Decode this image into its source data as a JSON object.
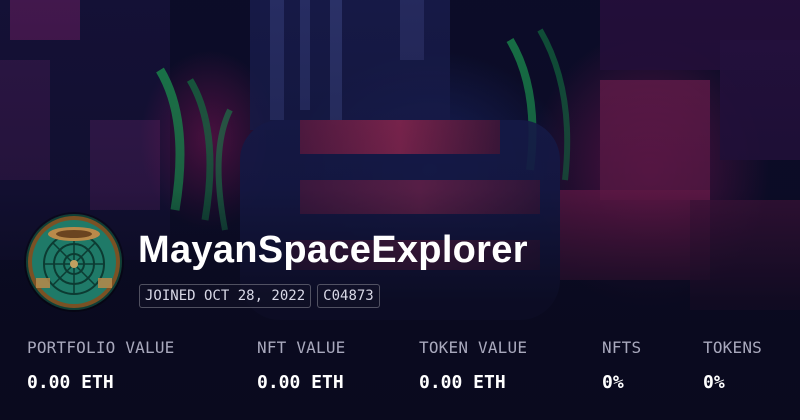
{
  "profile": {
    "name": "MayanSpaceExplorer",
    "joined": "JOINED OCT 28, 2022",
    "address_short": "C04873"
  },
  "stats": [
    {
      "label": "PORTFOLIO VALUE",
      "value": "0.00 ETH"
    },
    {
      "label": "NFT VALUE",
      "value": "0.00 ETH"
    },
    {
      "label": "TOKEN VALUE",
      "value": "0.00 ETH"
    },
    {
      "label": "NFTS",
      "value": "0%"
    },
    {
      "label": "TOKENS",
      "value": "0%"
    }
  ],
  "colors": {
    "background": "#0b0c24",
    "text_primary": "#ffffff",
    "text_secondary": "#a9a9bd",
    "accent_magenta": "#c2185b",
    "accent_green": "#2ecc71"
  }
}
